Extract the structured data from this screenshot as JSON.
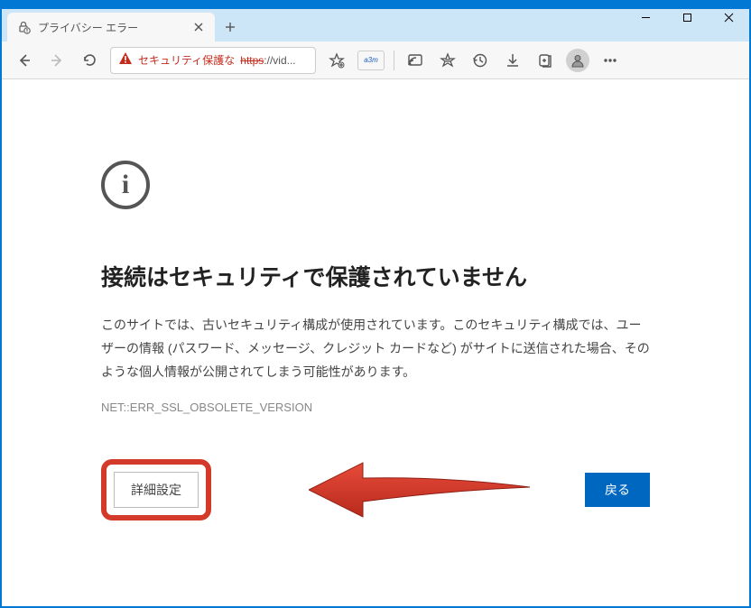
{
  "window": {
    "minimize": "—",
    "maximize": "☐",
    "close": "✕"
  },
  "tab": {
    "title": "プライバシー エラー",
    "close": "✕",
    "new": "+"
  },
  "address": {
    "warning": "セキュリティ保護な",
    "https": "https",
    "url": "://vid..."
  },
  "page": {
    "info_glyph": "i",
    "heading": "接続はセキュリティで保護されていません",
    "description": "このサイトでは、古いセキュリティ構成が使用されています。このセキュリティ構成では、ユーザーの情報 (パスワード、メッセージ、クレジット カードなど) がサイトに送信された場合、そのような個人情報が公開されてしまう可能性があります。",
    "error_code": "NET::ERR_SSL_OBSOLETE_VERSION",
    "advanced_label": "詳細設定",
    "back_label": "戻る"
  },
  "ext": {
    "label": "a3m"
  }
}
